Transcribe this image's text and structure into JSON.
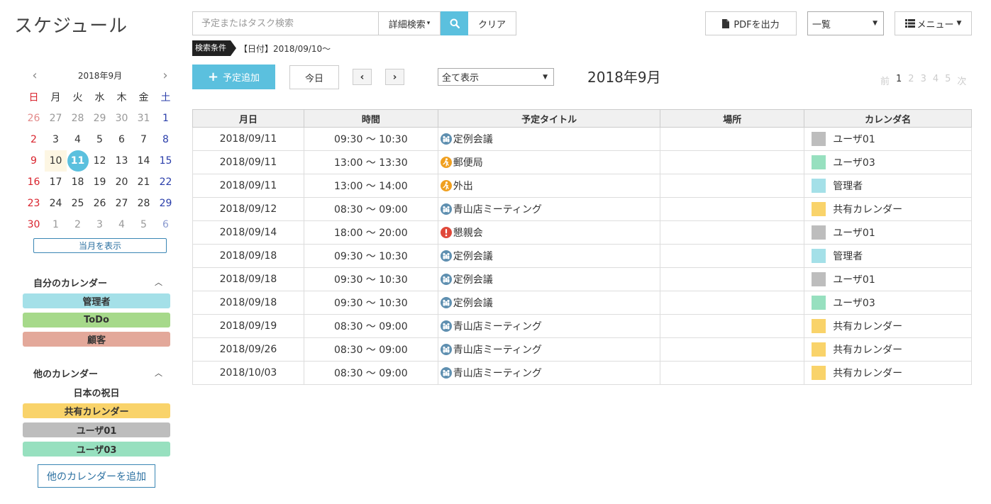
{
  "app": {
    "title": "スケジュール"
  },
  "search": {
    "placeholder": "予定またはタスク検索",
    "advanced_label": "詳細検索",
    "clear_label": "クリア"
  },
  "filter": {
    "tag": "検索条件",
    "text": "【日付】2018/09/10〜"
  },
  "header_right": {
    "pdf_label": "PDFを出力",
    "view_value": "一覧",
    "menu_label": "メニュー"
  },
  "toolbar": {
    "add_label": "予定追加",
    "today_label": "今日",
    "display_value": "全て表示",
    "month_title": "2018年9月"
  },
  "pager": {
    "prev": "前",
    "pages": [
      "1",
      "2",
      "3",
      "4",
      "5"
    ],
    "next": "次"
  },
  "mini_calendar": {
    "month": "2018年9月",
    "weekdays": [
      "日",
      "月",
      "火",
      "水",
      "木",
      "金",
      "土"
    ],
    "days": [
      [
        "26",
        "27",
        "28",
        "29",
        "30",
        "31",
        "1"
      ],
      [
        "2",
        "3",
        "4",
        "5",
        "6",
        "7",
        "8"
      ],
      [
        "9",
        "10",
        "11",
        "12",
        "13",
        "14",
        "15"
      ],
      [
        "16",
        "17",
        "18",
        "19",
        "20",
        "21",
        "22"
      ],
      [
        "23",
        "24",
        "25",
        "26",
        "27",
        "28",
        "29"
      ],
      [
        "30",
        "1",
        "2",
        "3",
        "4",
        "5",
        "6"
      ]
    ],
    "today": "11",
    "show_month_label": "当月を表示"
  },
  "my_calendars": {
    "title": "自分のカレンダー",
    "items": [
      {
        "label": "管理者",
        "color": "#a4e0e8"
      },
      {
        "label": "ToDo",
        "color": "#a6d98a"
      },
      {
        "label": "顧客",
        "color": "#e3a89a"
      }
    ]
  },
  "other_calendars": {
    "title": "他のカレンダー",
    "plain_item": "日本の祝日",
    "items": [
      {
        "label": "共有カレンダー",
        "color": "#f9d36a"
      },
      {
        "label": "ユーザ01",
        "color": "#bdbdbd"
      },
      {
        "label": "ユーザ03",
        "color": "#97e0bf"
      }
    ],
    "add_label": "他のカレンダーを追加"
  },
  "table": {
    "headers": [
      "月日",
      "時間",
      "予定タイトル",
      "場所",
      "カレンダ名"
    ],
    "rows": [
      {
        "date": "2018/09/11",
        "time": "09:30 〜 10:30",
        "icon": "meeting-icon",
        "title": "定例会議",
        "place": "",
        "calendar": "ユーザ01",
        "color": "#bdbdbd"
      },
      {
        "date": "2018/09/11",
        "time": "13:00 〜 13:30",
        "icon": "outing-icon",
        "title": "郵便局",
        "place": "",
        "calendar": "ユーザ03",
        "color": "#97e0bf"
      },
      {
        "date": "2018/09/11",
        "time": "13:00 〜 14:00",
        "icon": "outing-icon",
        "title": "外出",
        "place": "",
        "calendar": "管理者",
        "color": "#a4e0e8"
      },
      {
        "date": "2018/09/12",
        "time": "08:30 〜 09:00",
        "icon": "meeting-icon",
        "title": "青山店ミーティング",
        "place": "",
        "calendar": "共有カレンダー",
        "color": "#f9d36a"
      },
      {
        "date": "2018/09/14",
        "time": "18:00 〜 20:00",
        "icon": "important-icon",
        "title": "懇親会",
        "place": "",
        "calendar": "ユーザ01",
        "color": "#bdbdbd"
      },
      {
        "date": "2018/09/18",
        "time": "09:30 〜 10:30",
        "icon": "meeting-icon",
        "title": "定例会議",
        "place": "",
        "calendar": "管理者",
        "color": "#a4e0e8"
      },
      {
        "date": "2018/09/18",
        "time": "09:30 〜 10:30",
        "icon": "meeting-icon",
        "title": "定例会議",
        "place": "",
        "calendar": "ユーザ01",
        "color": "#bdbdbd"
      },
      {
        "date": "2018/09/18",
        "time": "09:30 〜 10:30",
        "icon": "meeting-icon",
        "title": "定例会議",
        "place": "",
        "calendar": "ユーザ03",
        "color": "#97e0bf"
      },
      {
        "date": "2018/09/19",
        "time": "08:30 〜 09:00",
        "icon": "meeting-icon",
        "title": "青山店ミーティング",
        "place": "",
        "calendar": "共有カレンダー",
        "color": "#f9d36a"
      },
      {
        "date": "2018/09/26",
        "time": "08:30 〜 09:00",
        "icon": "meeting-icon",
        "title": "青山店ミーティング",
        "place": "",
        "calendar": "共有カレンダー",
        "color": "#f9d36a"
      },
      {
        "date": "2018/10/03",
        "time": "08:30 〜 09:00",
        "icon": "meeting-icon",
        "title": "青山店ミーティング",
        "place": "",
        "calendar": "共有カレンダー",
        "color": "#f9d36a"
      }
    ]
  },
  "colors": {
    "accent": "#5bc0de",
    "link": "#2a6fa0",
    "sunday": "#d9232d",
    "saturday": "#2a3eaa"
  }
}
